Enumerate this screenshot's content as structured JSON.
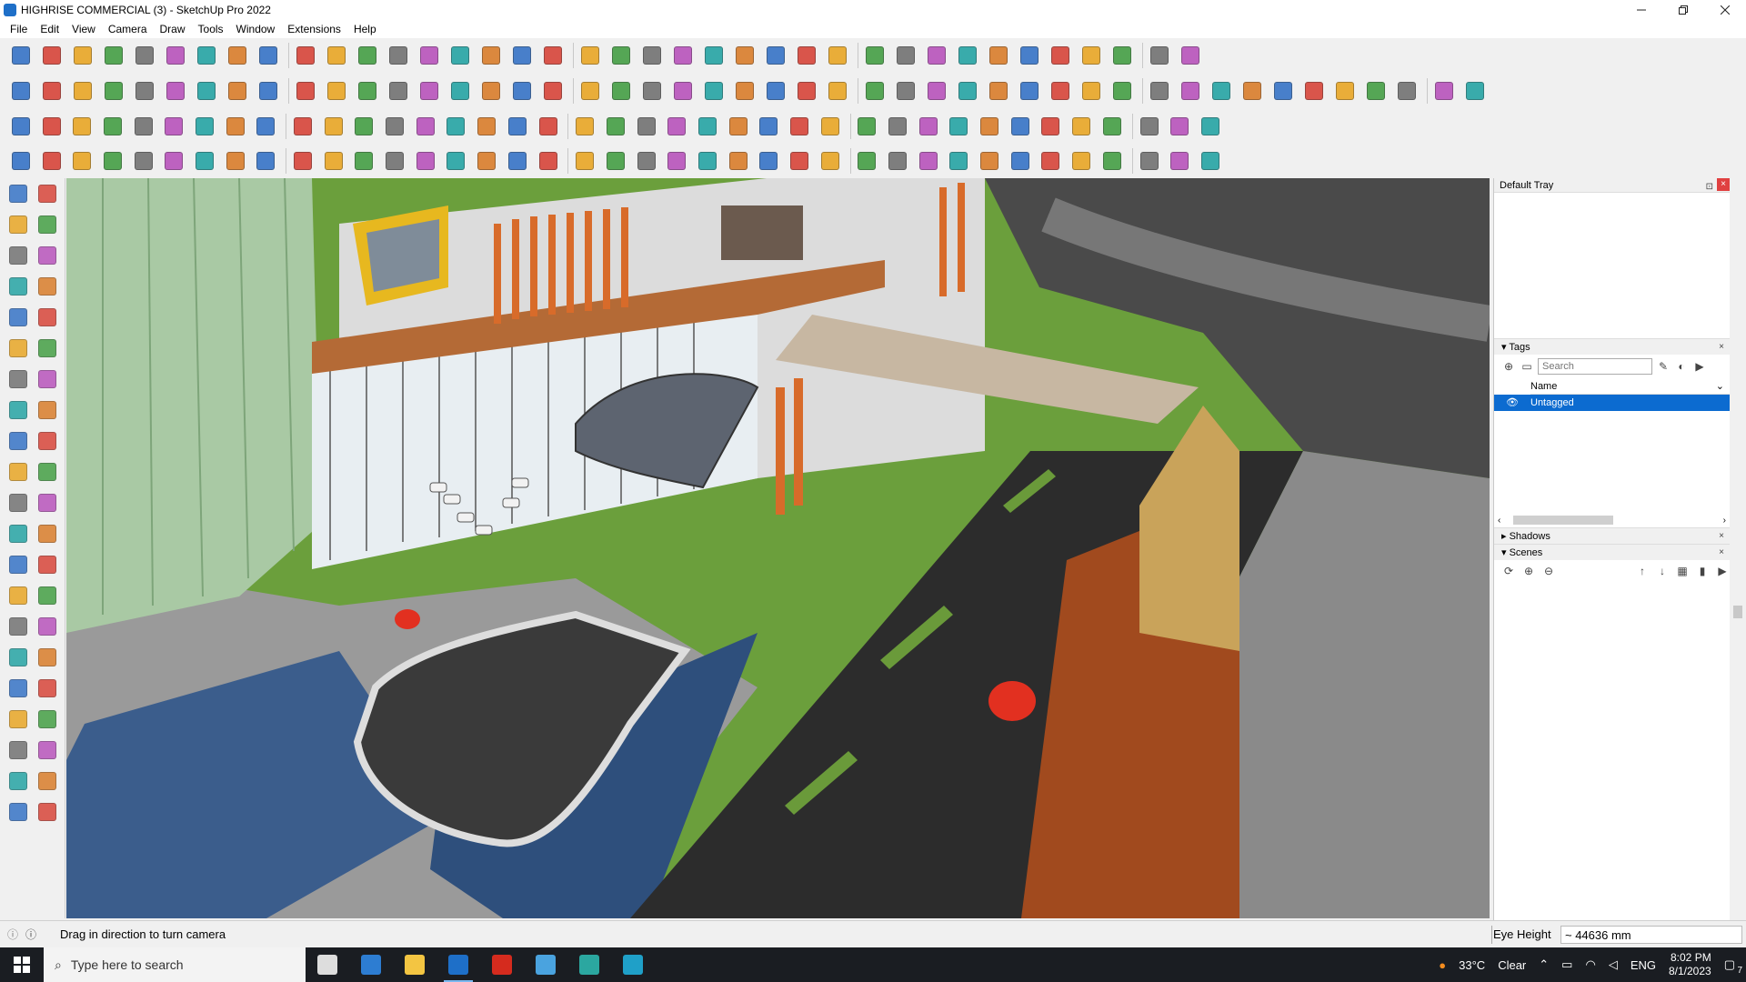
{
  "window": {
    "title": "HIGHRISE COMMERCIAL (3) - SketchUp Pro 2022",
    "controls": [
      "minimize",
      "maximize",
      "close"
    ]
  },
  "menu": [
    "File",
    "Edit",
    "View",
    "Camera",
    "Draw",
    "Tools",
    "Window",
    "Extensions",
    "Help"
  ],
  "toolbars": {
    "row1_icons": [
      "zoom-extents",
      "select",
      "select-dropdown",
      "eraser",
      "line-tool",
      "line-dropdown",
      "arc",
      "arc-dropdown",
      "rectangle",
      "rectangle-dropdown",
      "push-pull",
      "follow-me",
      "move",
      "rotate",
      "scale",
      "tape-measure",
      "text",
      "paint-bucket",
      "orbit",
      "pan",
      "zoom",
      "zoom-window",
      "sandbox-contours",
      "sandbox-grid",
      "sandbox-smoove",
      "sandbox-stamp",
      "warehouse",
      "warehouse-dropdown",
      "extension-warehouse",
      "layout",
      "scene-1",
      "scene-2",
      "scene-3",
      "axes",
      "section",
      "undo",
      "redo",
      "delete"
    ],
    "row2_icons": [
      "xray",
      "back-edges",
      "wireframe",
      "hidden-line",
      "shaded",
      "shaded-textures",
      "monochrome",
      "front-view",
      "top-view",
      "right-view",
      "back-view",
      "left-view",
      "iso-view",
      "push",
      "add-r",
      "add-v",
      "add-n",
      "add-x",
      "add-f",
      "house-1",
      "house-2",
      "house-3",
      "house-4",
      "house-5",
      "house-6",
      "solid-1",
      "solid-2",
      "solid-3",
      "solid-4",
      "solid-5",
      "solid-6",
      "solid-7",
      "fredo-1",
      "fredo-2",
      "pencil",
      "shape-1",
      "shape-2",
      "shape-3",
      "shape-4",
      "shape-5",
      "shape-6",
      "shape-7",
      "shape-8",
      "shape-9",
      "shape-10",
      "shape-11",
      "shape-12"
    ],
    "row3_icons": [
      "face-blue",
      "face-cyan",
      "face-yellow",
      "face-green",
      "face-red",
      "face-gray",
      "arc-orange",
      "rect-red",
      "grid",
      "window",
      "wood",
      "link",
      "bracket",
      "curve-orange",
      "cross-red",
      "cross-green",
      "cross-blue",
      "cone",
      "stair",
      "warning",
      "spiral",
      "knot",
      "loop",
      "axes-blue",
      "cube",
      "magnet",
      "green-s",
      "robot-1",
      "robot-2",
      "robot-3",
      "cube-red",
      "gear",
      "box",
      "tile-1",
      "tile-2",
      "tile-3",
      "x-red",
      "bezier",
      "grid-2"
    ],
    "row4_icons": [
      "draw-1",
      "draw-2",
      "draw-3",
      "draw-4",
      "draw-5",
      "draw-6",
      "draw-7",
      "draw-8",
      "draw-9",
      "draw-10",
      "draw-11",
      "draw-12",
      "draw-13",
      "draw-14",
      "draw-15",
      "draw-16",
      "draw-17",
      "draw-18",
      "draw-19",
      "draw-20",
      "draw-21",
      "draw-22",
      "draw-23",
      "draw-24",
      "draw-25",
      "draw-26",
      "draw-27",
      "draw-28",
      "draw-29",
      "draw-30",
      "draw-31",
      "draw-32",
      "draw-33",
      "draw-34",
      "draw-35",
      "draw-36",
      "draw-37",
      "draw-38",
      "draw-39"
    ]
  },
  "left_palette_icons": [
    "select",
    "orbit",
    "paint",
    "eraser",
    "component",
    "tape",
    "line",
    "freehand",
    "rectangle",
    "rotated-rect",
    "circle",
    "polygon",
    "arc",
    "pie",
    "arc-2p",
    "arc-3p",
    "move",
    "push-pull",
    "rotate",
    "follow-me",
    "scale",
    "offset",
    "tape-measure",
    "dimension",
    "protractor",
    "text",
    "axes",
    "3d-text",
    "orbit-2",
    "pan",
    "zoom",
    "zoom-window",
    "zoom-extents",
    "prev-view",
    "position-camera",
    "look-around",
    "walk",
    "section-plane",
    "sandbox-1",
    "sandbox-2",
    "sandbox-3",
    "sandbox-4"
  ],
  "tray": {
    "title": "Default Tray",
    "tags": {
      "title": "Tags",
      "search_placeholder": "Search",
      "column_name": "Name",
      "items": [
        "Untagged"
      ]
    },
    "shadows": {
      "title": "Shadows"
    },
    "scenes": {
      "title": "Scenes"
    }
  },
  "status": {
    "message": "Drag in direction to turn camera",
    "measurement_label": "Eye Height",
    "measurement_value": "~ 44636 mm"
  },
  "taskbar": {
    "search_placeholder": "Type here to search",
    "apps": [
      "task-view",
      "calculator",
      "file-explorer",
      "sketchup",
      "acrobat",
      "snipping",
      "edge",
      "app-3"
    ],
    "weather_temp": "33°C",
    "weather_desc": "Clear",
    "language": "ENG",
    "time": "8:02 PM",
    "date": "8/1/2023",
    "notification_count": "7"
  },
  "colors": {
    "selection": "#0c6bd0",
    "grass": "#6b9f3c",
    "road": "#2c2c2c",
    "water": "#3b5d8c",
    "facade_orange": "#d86b2a"
  }
}
